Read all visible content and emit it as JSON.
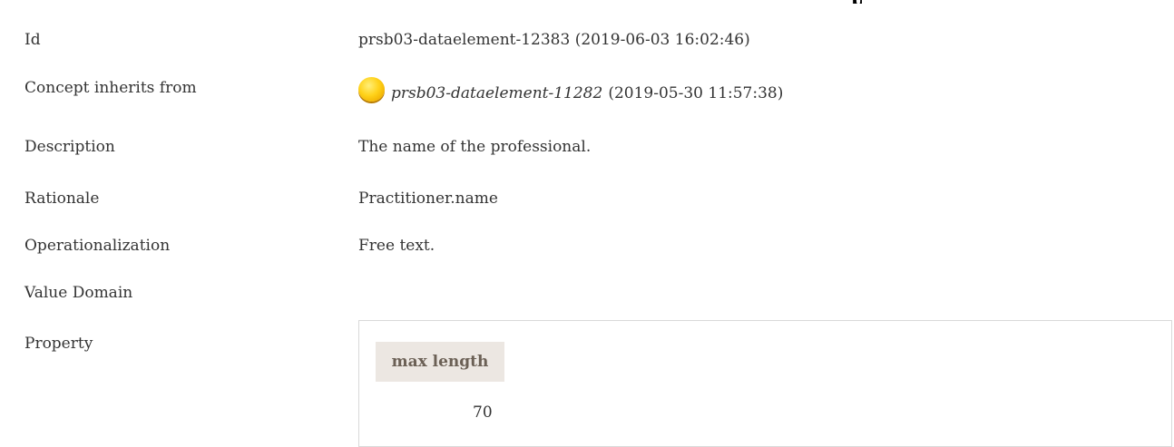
{
  "rows": {
    "id": {
      "label": "Id",
      "value": "prsb03-dataelement-12383 (2019-06-03 16:02:46)"
    },
    "inherits": {
      "label": "Concept inherits from",
      "link": "prsb03-dataelement-11282",
      "date": "(2019-05-30 11:57:38)",
      "status_icon": "status-circle-yellow-icon",
      "status_color": "#ffd21a"
    },
    "description": {
      "label": "Description",
      "value": "The name of the professional."
    },
    "rationale": {
      "label": "Rationale",
      "value": "Practitioner.name"
    },
    "operationalization": {
      "label": "Operationalization",
      "value": "Free text."
    },
    "value_domain": {
      "label": "Value Domain"
    },
    "property": {
      "label": "Property",
      "header": "max length",
      "value": "70"
    }
  },
  "colors": {
    "text": "#333333",
    "property_header_bg": "#ece7e2",
    "property_header_text": "#6b6055",
    "box_border": "#d9d9d9"
  }
}
